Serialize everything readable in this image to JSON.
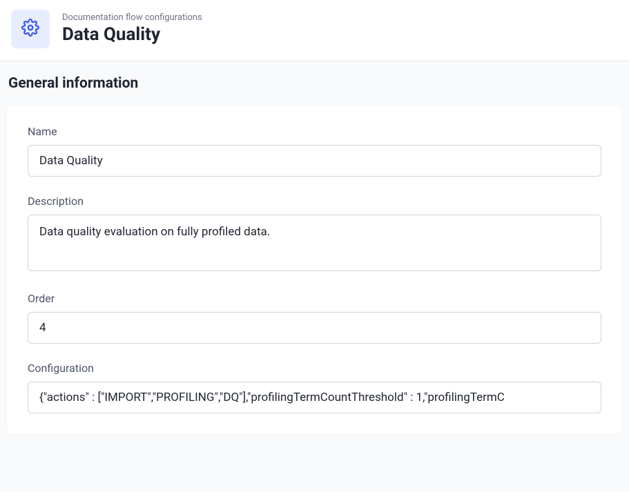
{
  "header": {
    "breadcrumb": "Documentation flow configurations",
    "title": "Data Quality",
    "icon": "gear-icon"
  },
  "section": {
    "title": "General information"
  },
  "form": {
    "name": {
      "label": "Name",
      "value": "Data Quality"
    },
    "description": {
      "label": "Description",
      "value": "Data quality evaluation on fully profiled data."
    },
    "order": {
      "label": "Order",
      "value": "4"
    },
    "configuration": {
      "label": "Configuration",
      "value": "{\"actions\" : [\"IMPORT\",\"PROFILING\",\"DQ\"],\"profilingTermCountThreshold\" : 1,\"profilingTermC"
    }
  }
}
